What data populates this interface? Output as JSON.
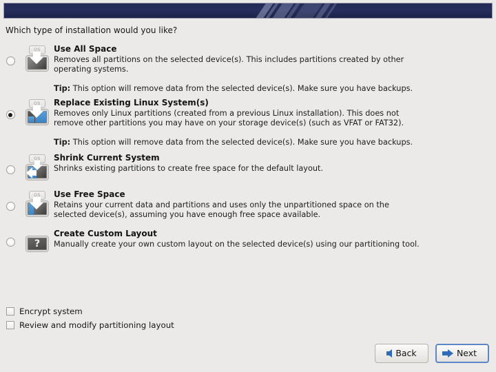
{
  "header": {
    "banner_color": "#262d5a",
    "banner_border": "#9a9ab0"
  },
  "question": "Which type of installation would you like?",
  "options": [
    {
      "id": "use-all-space",
      "title": "Use All Space",
      "description": "Removes all partitions on the selected device(s).  This includes partitions created by other operating systems.",
      "tip_label": "Tip:",
      "tip": "This option will remove data from the selected device(s).  Make sure you have backups.",
      "selected": false,
      "icon": "drive-all-space-icon"
    },
    {
      "id": "replace-existing-linux",
      "title": "Replace Existing Linux System(s)",
      "description": "Removes only Linux partitions (created from a previous Linux installation).  This does not remove other partitions you may have on your storage device(s) (such as VFAT or FAT32).",
      "tip_label": "Tip:",
      "tip": "This option will remove data from the selected device(s).  Make sure you have backups.",
      "selected": true,
      "icon": "drive-replace-linux-icon"
    },
    {
      "id": "shrink-current-system",
      "title": "Shrink Current System",
      "description": "Shrinks existing partitions to create free space for the default layout.",
      "tip_label": "",
      "tip": "",
      "selected": false,
      "icon": "drive-shrink-icon"
    },
    {
      "id": "use-free-space",
      "title": "Use Free Space",
      "description": "Retains your current data and partitions and uses only the unpartitioned space on the selected device(s), assuming you have enough free space available.",
      "tip_label": "",
      "tip": "",
      "selected": false,
      "icon": "drive-free-space-icon"
    },
    {
      "id": "create-custom-layout",
      "title": "Create Custom Layout",
      "description": "Manually create your own custom layout on the selected device(s) using our partitioning tool.",
      "tip_label": "",
      "tip": "",
      "selected": false,
      "icon": "drive-custom-layout-icon"
    }
  ],
  "icon_badge_text": "OS",
  "checkboxes": [
    {
      "id": "encrypt-system",
      "label": "Encrypt system",
      "checked": false
    },
    {
      "id": "review-modify-partitioning",
      "label": "Review and modify partitioning layout",
      "checked": false
    }
  ],
  "buttons": {
    "back": {
      "label": "Back",
      "icon": "arrow-left-icon",
      "focused": false
    },
    "next": {
      "label": "Next",
      "icon": "arrow-right-icon",
      "focused": true
    }
  },
  "colors": {
    "background": "#ebeae8",
    "banner": "#262d5a",
    "accent_blue": "#3c84c4",
    "button_arrow": "#2f6cb5",
    "focus_border": "#5d87c4"
  }
}
